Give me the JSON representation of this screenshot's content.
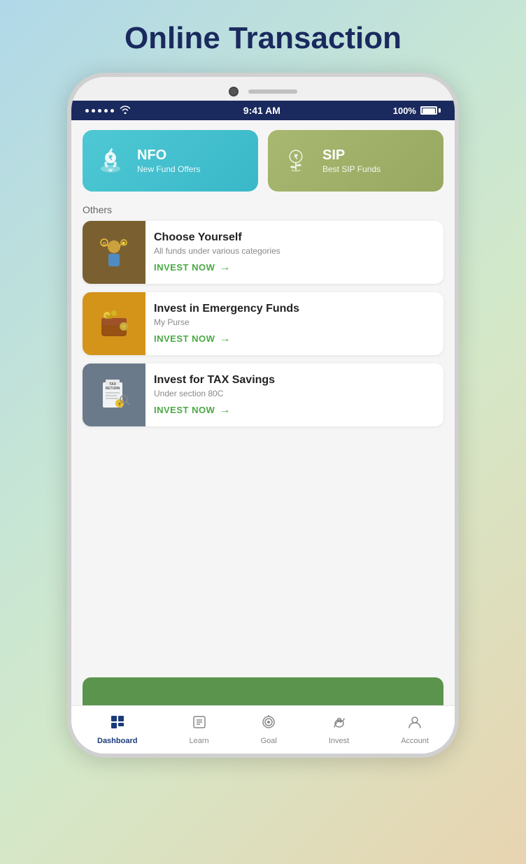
{
  "page": {
    "title": "Online Transaction",
    "background_color_start": "#b0d8e8",
    "background_color_end": "#d4e8c8"
  },
  "status_bar": {
    "time": "9:41 AM",
    "battery": "100%",
    "signal_dots": [
      "•",
      "•",
      "•",
      "•",
      "•"
    ]
  },
  "cards": [
    {
      "id": "nfo",
      "title": "NFO",
      "subtitle": "New Fund Offers",
      "color_start": "#4ec8d4",
      "color_end": "#3ab8c8",
      "icon": "nfo-icon"
    },
    {
      "id": "sip",
      "title": "SIP",
      "subtitle": "Best SIP Funds",
      "color_start": "#a8b870",
      "color_end": "#98a860",
      "icon": "sip-icon"
    }
  ],
  "others_label": "Others",
  "list_items": [
    {
      "id": "choose-yourself",
      "title": "Choose Yourself",
      "subtitle": "All funds under various categories",
      "cta": "INVEST NOW",
      "icon_bg": "#7a6030",
      "icon": "choose-icon"
    },
    {
      "id": "emergency-funds",
      "title": "Invest in Emergency Funds",
      "subtitle": "My Purse",
      "cta": "INVEST NOW",
      "icon_bg": "#d4941a",
      "icon": "emergency-icon"
    },
    {
      "id": "tax-savings",
      "title": "Invest for TAX Savings",
      "subtitle": "Under section 80C",
      "cta": "INVEST NOW",
      "icon_bg": "#6a7a8a",
      "icon": "tax-icon"
    }
  ],
  "nav_items": [
    {
      "id": "dashboard",
      "label": "Dashboard",
      "icon": "dashboard-icon",
      "active": true
    },
    {
      "id": "learn",
      "label": "Learn",
      "icon": "learn-icon",
      "active": false
    },
    {
      "id": "goal",
      "label": "Goal",
      "icon": "goal-icon",
      "active": false
    },
    {
      "id": "invest",
      "label": "Invest",
      "icon": "invest-icon",
      "active": false
    },
    {
      "id": "account",
      "label": "Account",
      "icon": "account-icon",
      "active": false
    }
  ]
}
